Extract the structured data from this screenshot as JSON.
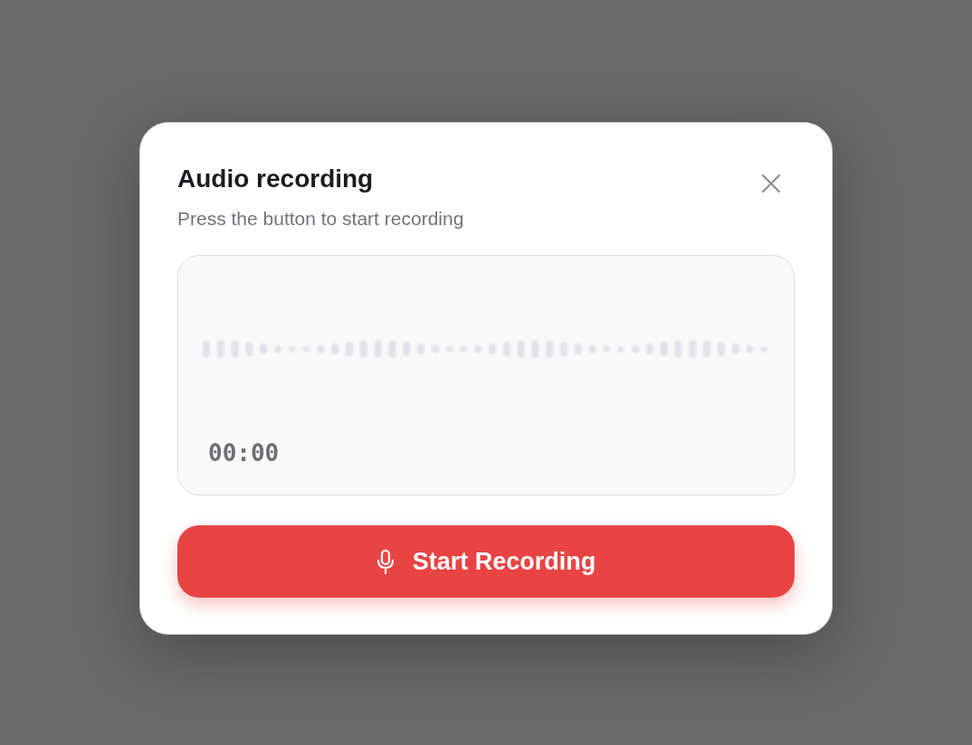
{
  "dialog": {
    "title": "Audio recording",
    "subtitle": "Press the button to start recording"
  },
  "recorder": {
    "timer": "00:00"
  },
  "record_button": {
    "label": "Start Recording"
  }
}
